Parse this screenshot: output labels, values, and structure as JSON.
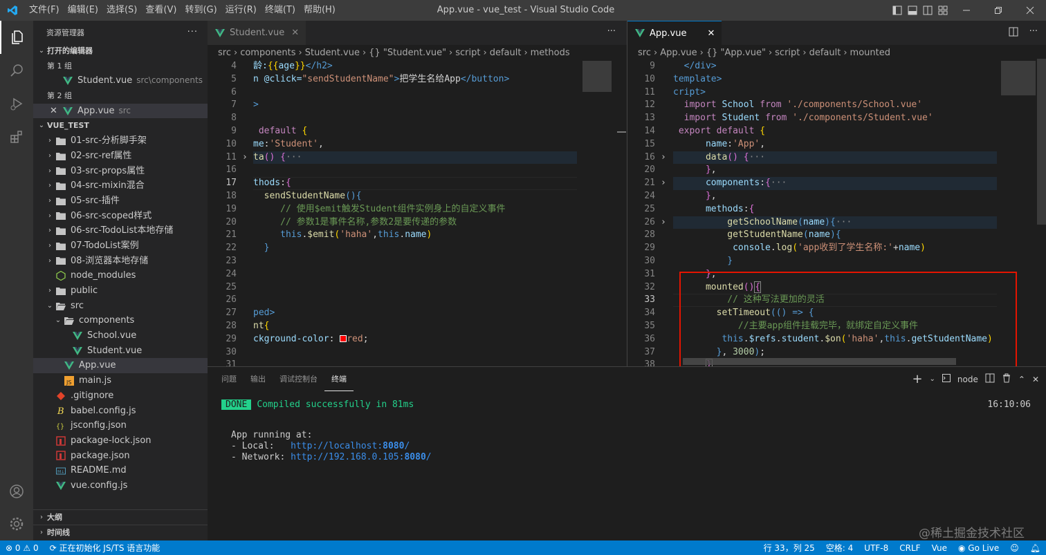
{
  "menu": [
    "文件(F)",
    "编辑(E)",
    "选择(S)",
    "查看(V)",
    "转到(G)",
    "运行(R)",
    "终端(T)",
    "帮助(H)"
  ],
  "window_title": "App.vue - vue_test - Visual Studio Code",
  "explorer": {
    "title": "资源管理器",
    "open_editors": "打开的编辑器",
    "group1": "第 1 组",
    "group1_file": "Student.vue",
    "group1_path": "src\\components",
    "group2": "第 2 组",
    "group2_file": "App.vue",
    "group2_path": "src",
    "project": "VUE_TEST",
    "tree": [
      {
        "name": "01-src-分析脚手架",
        "type": "folder",
        "depth": 1
      },
      {
        "name": "02-src-ref属性",
        "type": "folder",
        "depth": 1
      },
      {
        "name": "03-src-props属性",
        "type": "folder",
        "depth": 1
      },
      {
        "name": "04-src-mixin混合",
        "type": "folder",
        "depth": 1
      },
      {
        "name": "05-src-插件",
        "type": "folder",
        "depth": 1
      },
      {
        "name": "06-src-scoped样式",
        "type": "folder",
        "depth": 1
      },
      {
        "name": "06-src-TodoList本地存储",
        "type": "folder",
        "depth": 1
      },
      {
        "name": "07-TodoList案例",
        "type": "folder",
        "depth": 1
      },
      {
        "name": "08-浏览器本地存储",
        "type": "folder",
        "depth": 1
      },
      {
        "name": "node_modules",
        "type": "node",
        "depth": 1
      },
      {
        "name": "public",
        "type": "folder",
        "depth": 1
      },
      {
        "name": "src",
        "type": "open",
        "depth": 1
      },
      {
        "name": "components",
        "type": "open",
        "depth": 2
      },
      {
        "name": "School.vue",
        "type": "vue",
        "depth": 3
      },
      {
        "name": "Student.vue",
        "type": "vue",
        "depth": 3
      },
      {
        "name": "App.vue",
        "type": "vue",
        "depth": 2
      },
      {
        "name": "main.js",
        "type": "js",
        "depth": 2
      },
      {
        "name": ".gitignore",
        "type": "git",
        "depth": 1
      },
      {
        "name": "babel.config.js",
        "type": "babel",
        "depth": 1
      },
      {
        "name": "jsconfig.json",
        "type": "json",
        "depth": 1
      },
      {
        "name": "package-lock.json",
        "type": "npm",
        "depth": 1
      },
      {
        "name": "package.json",
        "type": "npm",
        "depth": 1
      },
      {
        "name": "README.md",
        "type": "md",
        "depth": 1
      },
      {
        "name": "vue.config.js",
        "type": "vue",
        "depth": 1
      }
    ],
    "outline": "大纲",
    "timeline": "时间线"
  },
  "editor1": {
    "tab": "Student.vue",
    "crumbs": [
      "src",
      "components",
      "Student.vue",
      "{} \"Student.vue\"",
      "script",
      "default",
      "methods"
    ],
    "lines": [
      {
        "n": "4",
        "html": "<span class='prop'>龄:</span><span class='yb'>{{</span><span class='prop'>age</span><span class='yb'>}}</span><span class='tag'>&lt;/h2&gt;</span>"
      },
      {
        "n": "5",
        "html": "<span class='prop'>n @click=</span><span class='str'>\"sendStudentName\"</span><span class='tag'>&gt;</span>把学生名给App<span class='tag'>&lt;/button&gt;</span>"
      },
      {
        "n": "6",
        "html": ""
      },
      {
        "n": "7",
        "html": "<span class='tag'>&gt;</span>"
      },
      {
        "n": "8",
        "html": ""
      },
      {
        "n": "9",
        "html": " <span class='kp'>default</span> <span class='yb'>{</span>"
      },
      {
        "n": "10",
        "html": "<span class='prop'>me</span>:<span class='str'>'Student'</span>,"
      },
      {
        "n": "11",
        "html": "<span class='fn'>ta</span><span class='br'>()</span> <span class='br'>{</span><span style='color:#888'>···</span>"
      },
      {
        "n": "16",
        "html": ""
      },
      {
        "n": "17",
        "html": "<span class='prop'>thods</span>:<span class='br'>{</span>"
      },
      {
        "n": "18",
        "html": "  <span class='fn'>sendStudentName</span><span class='kw'>(){</span>"
      },
      {
        "n": "19",
        "html": "     <span class='cm'>// 使用$emit触发Student组件实例身上的自定义事件</span>"
      },
      {
        "n": "20",
        "html": "     <span class='cm'>// 参数1是事件名称,参数2是要传递的参数</span>"
      },
      {
        "n": "21",
        "html": "     <span class='kw'>this</span>.<span class='fn'>$emit</span><span class='yb'>(</span><span class='str'>'haha'</span>,<span class='kw'>this</span>.<span class='prop'>name</span><span class='yb'>)</span>"
      },
      {
        "n": "22",
        "html": "  <span class='kw'>}</span>"
      },
      {
        "n": "23",
        "html": ""
      },
      {
        "n": "24",
        "html": ""
      },
      {
        "n": "25",
        "html": ""
      },
      {
        "n": "26",
        "html": ""
      },
      {
        "n": "27",
        "html": "<span class='tag'>ped&gt;</span>"
      },
      {
        "n": "28",
        "html": "<span class='fn'>nt</span><span class='yb'>{</span>"
      },
      {
        "n": "29",
        "html": "<span class='prop'>ckground-color</span>: <span style='display:inline-block;width:10px;height:10px;background:#ff0000;border:1px solid #fff;vertical-align:middle'></span><span class='str'>red</span>;"
      },
      {
        "n": "30",
        "html": ""
      },
      {
        "n": "31",
        "html": ""
      }
    ]
  },
  "editor2": {
    "tab": "App.vue",
    "crumbs": [
      "src",
      "App.vue",
      "{} \"App.vue\"",
      "script",
      "default",
      "mounted"
    ],
    "lines": [
      {
        "n": "9",
        "html": "  <span class='tag'>&lt;/div&gt;</span>"
      },
      {
        "n": "10",
        "html": "<span class='tag'>template&gt;</span>"
      },
      {
        "n": "11",
        "html": "<span class='tag'>cript&gt;</span>"
      },
      {
        "n": "12",
        "html": "  <span class='kp'>import</span> <span class='prop'>School</span> <span class='kp'>from</span> <span class='str'>'./components/School.vue'</span>"
      },
      {
        "n": "13",
        "html": "  <span class='kp'>import</span> <span class='prop'>Student</span> <span class='kp'>from</span> <span class='str'>'./components/Student.vue'</span>"
      },
      {
        "n": "14",
        "html": " <span class='kp'>export</span> <span class='kp'>default</span> <span class='yb'>{</span>"
      },
      {
        "n": "15",
        "html": "      <span class='prop'>name</span>:<span class='str'>'App'</span>,"
      },
      {
        "n": "16",
        "html": "      <span class='fn'>data</span><span class='br'>()</span> <span class='br'>{</span><span style='color:#888'>···</span>"
      },
      {
        "n": "20",
        "html": "      <span class='br'>}</span>,"
      },
      {
        "n": "21",
        "html": "      <span class='prop'>components</span>:<span class='br'>{</span><span style='color:#888'>···</span>"
      },
      {
        "n": "24",
        "html": "      <span class='br'>}</span>,"
      },
      {
        "n": "25",
        "html": "      <span class='prop'>methods</span>:<span class='br'>{</span>"
      },
      {
        "n": "26",
        "html": "          <span class='fn'>getSchoolName</span><span class='kw'>(</span><span class='prop'>name</span><span class='kw'>){</span><span style='color:#888'>···</span>"
      },
      {
        "n": "28",
        "html": "          <span class='fn'>getStudentName</span><span class='kw'>(</span><span class='prop'>name</span><span class='kw'>){</span>"
      },
      {
        "n": "29",
        "html": "           <span class='prop'>console</span>.<span class='fn'>log</span><span class='yb'>(</span><span class='str'>'app收到了学生名称:'</span>+<span class='prop'>name</span><span class='yb'>)</span>"
      },
      {
        "n": "30",
        "html": "          <span class='kw'>}</span>"
      },
      {
        "n": "31",
        "html": "      <span class='br'>}</span>,"
      },
      {
        "n": "32",
        "html": "      <span class='fn'>mounted</span><span class='br'>()</span><span class='br' style='border:1px solid #888'>{</span>"
      },
      {
        "n": "33",
        "html": "          <span class='cm'>// 这种写法更加的灵活</span>"
      },
      {
        "n": "34",
        "html": "        <span class='fn'>setTimeout</span><span class='kw'>(() =&gt; {</span>"
      },
      {
        "n": "35",
        "html": "            <span class='cm'>//主要app组件挂载完毕，就绑定自定义事件</span>"
      },
      {
        "n": "36",
        "html": "         <span class='kw'>this</span>.<span class='prop'>$refs</span>.<span class='prop'>student</span>.<span class='fn'>$on</span><span class='yb'>(</span><span class='str'>'haha'</span>,<span class='kw'>this</span>.<span class='prop'>getStudentName</span><span class='yb'>)</span>"
      },
      {
        "n": "37",
        "html": "        <span class='kw'>}</span>, <span style='color:#b5cea8'>3000</span><span class='kw'>)</span>;"
      },
      {
        "n": "38",
        "html": "      <span class='br' style='border:1px solid #888'>}</span>"
      }
    ]
  },
  "panel": {
    "tabs": [
      "问题",
      "输出",
      "调试控制台",
      "终端"
    ],
    "active_tab": "终端",
    "shell": "node",
    "done_badge": "DONE",
    "compiled": "Compiled successfully in 81ms",
    "time": "16:10:06",
    "running": "App running at:",
    "local_label": "- Local:   ",
    "local_url_pre": "http://localhost:",
    "network_label": "- Network: ",
    "network_url_pre": "http://192.168.0.105:",
    "port": "8080",
    "slash": "/"
  },
  "status": {
    "errors": "0",
    "warnings": "0",
    "init": "正在初始化 JS/TS 语言功能",
    "position": "行 33，列 25",
    "spaces": "空格: 4",
    "encoding": "UTF-8",
    "eol": "CRLF",
    "lang": "Vue",
    "golive": "Go Live",
    "watermark": "@稀土掘金技术社区"
  },
  "colors": {
    "accent": "#007acc",
    "highlight_box": "#e51400"
  }
}
